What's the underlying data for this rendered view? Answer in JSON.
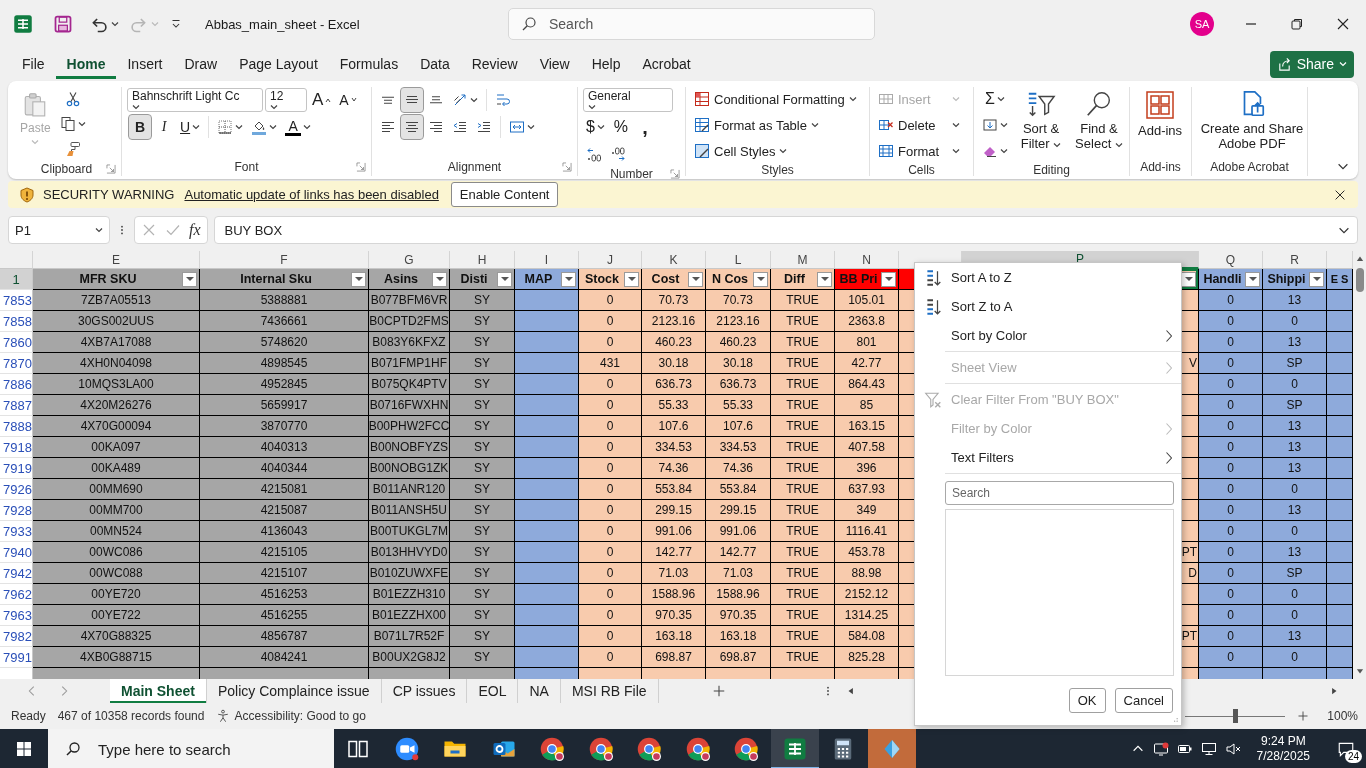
{
  "window": {
    "title": "Abbas_main_sheet - Excel",
    "search_placeholder": "Search",
    "user_initials": "SA"
  },
  "menu_tabs": [
    {
      "label": "File",
      "selected": false
    },
    {
      "label": "Home",
      "selected": true
    },
    {
      "label": "Insert",
      "selected": false
    },
    {
      "label": "Draw",
      "selected": false
    },
    {
      "label": "Page Layout",
      "selected": false
    },
    {
      "label": "Formulas",
      "selected": false
    },
    {
      "label": "Data",
      "selected": false
    },
    {
      "label": "Review",
      "selected": false
    },
    {
      "label": "View",
      "selected": false
    },
    {
      "label": "Help",
      "selected": false
    },
    {
      "label": "Acrobat",
      "selected": false
    }
  ],
  "share_button": "Share",
  "ribbon": {
    "groups": [
      {
        "kind": "clipboard",
        "label": "Clipboard",
        "launcher": true,
        "paste_label": "Paste",
        "paste_disabled": true
      },
      {
        "kind": "font",
        "label": "Font",
        "launcher": true,
        "font_name": "Bahnschrift Light Cc",
        "font_size": "12",
        "grow_label": "A",
        "shrink_label": "A",
        "bold_label": "B",
        "italic_label": "I",
        "underline_label": "U",
        "font_color_label": "A",
        "bold": true,
        "italic": false,
        "underline": false
      },
      {
        "kind": "alignment",
        "label": "Alignment",
        "launcher": true,
        "vertical_align": [
          {
            "selected": false
          },
          {
            "selected": true
          },
          {
            "selected": false
          }
        ],
        "horizontal_align": [
          {
            "selected": false
          },
          {
            "selected": true
          },
          {
            "selected": false
          }
        ]
      },
      {
        "kind": "number",
        "label": "Number",
        "launcher": true,
        "format": "General",
        "currency_label": "$",
        "percent_label": "%",
        "comma_label": ","
      },
      {
        "kind": "styles",
        "label": "Styles",
        "launcher": false,
        "commands": [
          "Conditional Formatting",
          "Format as Table",
          "Cell Styles"
        ]
      },
      {
        "kind": "cells",
        "label": "Cells",
        "launcher": false,
        "commands": [
          {
            "label": "Insert",
            "disabled": true
          },
          {
            "label": "Delete",
            "disabled": false
          },
          {
            "label": "Format",
            "disabled": false
          }
        ]
      },
      {
        "kind": "editing",
        "label": "Editing",
        "launcher": false,
        "sum_label": "Σ",
        "sort_filter": "Sort & Filter",
        "find_select": "Find & Select"
      },
      {
        "kind": "addins",
        "label": "Add-ins",
        "launcher": false,
        "button": "Add-ins"
      },
      {
        "kind": "acrobat",
        "label": "Adobe Acrobat",
        "launcher": false,
        "button": "Create and Share Adobe PDF"
      }
    ]
  },
  "security_bar": {
    "title": "SECURITY WARNING",
    "message": "Automatic update of links has been disabled",
    "button": "Enable Content"
  },
  "formula_bar": {
    "name_box": "P1",
    "function_label": "fx",
    "formula": "BUY BOX"
  },
  "sheet": {
    "header_row_number": "1",
    "header_row_selected": true,
    "columns": [
      {
        "letter": "E",
        "header": {
          "label": "MFR SKU",
          "color": "#a6a6a6"
        },
        "color": "#a6a6a6",
        "filter": true,
        "selected": false
      },
      {
        "letter": "F",
        "header": {
          "label": "Internal Sku",
          "color": "#a6a6a6"
        },
        "color": "#a6a6a6",
        "filter": true,
        "selected": false
      },
      {
        "letter": "G",
        "header": {
          "label": "Asins",
          "color": "#a6a6a6"
        },
        "color": "#a6a6a6",
        "filter": true,
        "selected": false
      },
      {
        "letter": "H",
        "header": {
          "label": "Disti",
          "color": "#a6a6a6"
        },
        "color": "#a6a6a6",
        "filter": true,
        "selected": false
      },
      {
        "letter": "I",
        "header": {
          "label": "MAP",
          "color": "#8eaadb"
        },
        "color": "#8eaadb",
        "filter": true,
        "selected": false
      },
      {
        "letter": "J",
        "header": {
          "label": "Stock",
          "color": "#f8cbad"
        },
        "color": "#f8cbad",
        "filter": true,
        "selected": false
      },
      {
        "letter": "K",
        "header": {
          "label": "Cost",
          "color": "#f8cbad"
        },
        "color": "#f8cbad",
        "filter": true,
        "selected": false
      },
      {
        "letter": "L",
        "header": {
          "label": "N Cos",
          "color": "#f8cbad"
        },
        "color": "#f8cbad",
        "filter": true,
        "selected": false
      },
      {
        "letter": "M",
        "header": {
          "label": "Diff",
          "color": "#f8cbad"
        },
        "color": "#f8cbad",
        "filter": true,
        "selected": false
      },
      {
        "letter": "N",
        "header": {
          "label": "BB Pri",
          "color": "#ff0000"
        },
        "color": "#f8cbad",
        "filter": true,
        "selected": false
      },
      {
        "header": {
          "color": "#ff0000"
        },
        "color": "#f8cbad",
        "selected": false
      },
      {
        "letter": "P",
        "header": {
          "color": "#f8cbad"
        },
        "color": "#f8cbad",
        "filter": true,
        "selected": true
      },
      {
        "letter": "Q",
        "header": {
          "label": "Handli",
          "color": "#8eaadb"
        },
        "color": "#8eaadb",
        "filter": true,
        "selected": false
      },
      {
        "letter": "R",
        "header": {
          "label": "Shippi",
          "color": "#8eaadb"
        },
        "color": "#8eaadb",
        "filter": true,
        "selected": false
      },
      {
        "header": {
          "label": "E S",
          "color": "#8eaadb"
        },
        "color": "#8eaadb",
        "filter": false,
        "selected": false
      }
    ],
    "rows": [
      {
        "number": "7853",
        "cells": {
          "E": "7ZB7A05513",
          "F": "5388881",
          "G": "B077BFM6VR",
          "H": "SY",
          "J": "0",
          "K": "70.73",
          "L": "70.73",
          "M": "TRUE",
          "N": "105.01",
          "Q": "0",
          "R": "13"
        }
      },
      {
        "number": "7858",
        "cells": {
          "E": "30GS002UUS",
          "F": "7436661",
          "G": "B0CPTD2FMS",
          "H": "SY",
          "J": "0",
          "K": "2123.16",
          "L": "2123.16",
          "M": "TRUE",
          "N": "2363.8",
          "Q": "0",
          "R": "0"
        }
      },
      {
        "number": "7860",
        "cells": {
          "E": "4XB7A17088",
          "F": "5748620",
          "G": "B083Y6KFXZ",
          "H": "SY",
          "J": "0",
          "K": "460.23",
          "L": "460.23",
          "M": "TRUE",
          "N": "801",
          "Q": "0",
          "R": "13"
        }
      },
      {
        "number": "7870",
        "cells": {
          "E": "4XH0N04098",
          "F": "4898545",
          "G": "B071FMP1HF",
          "H": "SY",
          "J": "431",
          "K": "30.18",
          "L": "30.18",
          "M": "TRUE",
          "N": "42.77",
          "P": "V",
          "Q": "0",
          "R": "SP"
        }
      },
      {
        "number": "7886",
        "cells": {
          "E": "10MQS3LA00",
          "F": "4952845",
          "G": "B075QK4PTV",
          "H": "SY",
          "J": "0",
          "K": "636.73",
          "L": "636.73",
          "M": "TRUE",
          "N": "864.43",
          "Q": "0",
          "R": "0"
        }
      },
      {
        "number": "7887",
        "cells": {
          "E": "4X20M26276",
          "F": "5659917",
          "G": "B0716FWXHN",
          "H": "SY",
          "J": "0",
          "K": "55.33",
          "L": "55.33",
          "M": "TRUE",
          "N": "85",
          "Q": "0",
          "R": "SP"
        }
      },
      {
        "number": "7888",
        "cells": {
          "E": "4X70G00094",
          "F": "3870770",
          "G": "B00PHW2FCC",
          "H": "SY",
          "J": "0",
          "K": "107.6",
          "L": "107.6",
          "M": "TRUE",
          "N": "163.15",
          "Q": "0",
          "R": "13"
        }
      },
      {
        "number": "7918",
        "cells": {
          "E": "00KA097",
          "F": "4040313",
          "G": "B00NOBFYZS",
          "H": "SY",
          "J": "0",
          "K": "334.53",
          "L": "334.53",
          "M": "TRUE",
          "N": "407.58",
          "Q": "0",
          "R": "13"
        }
      },
      {
        "number": "7919",
        "cells": {
          "E": "00KA489",
          "F": "4040344",
          "G": "B00NOBG1ZK",
          "H": "SY",
          "J": "0",
          "K": "74.36",
          "L": "74.36",
          "M": "TRUE",
          "N": "396",
          "Q": "0",
          "R": "13"
        }
      },
      {
        "number": "7926",
        "cells": {
          "E": "00MM690",
          "F": "4215081",
          "G": "B011ANR120",
          "H": "SY",
          "J": "0",
          "K": "553.84",
          "L": "553.84",
          "M": "TRUE",
          "N": "637.93",
          "Q": "0",
          "R": "0"
        }
      },
      {
        "number": "7928",
        "cells": {
          "E": "00MM700",
          "F": "4215087",
          "G": "B011ANSH5U",
          "H": "SY",
          "J": "0",
          "K": "299.15",
          "L": "299.15",
          "M": "TRUE",
          "N": "349",
          "Q": "0",
          "R": "13"
        }
      },
      {
        "number": "7933",
        "cells": {
          "E": "00MN524",
          "F": "4136043",
          "G": "B00TUKGL7M",
          "H": "SY",
          "J": "0",
          "K": "991.06",
          "L": "991.06",
          "M": "TRUE",
          "N": "1116.41",
          "Q": "0",
          "R": "0"
        }
      },
      {
        "number": "7940",
        "cells": {
          "E": "00WC086",
          "F": "4215105",
          "G": "B013HHVYD0",
          "H": "SY",
          "J": "0",
          "K": "142.77",
          "L": "142.77",
          "M": "TRUE",
          "N": "453.78",
          "P": "PT",
          "Q": "0",
          "R": "13"
        }
      },
      {
        "number": "7942",
        "cells": {
          "E": "00WC088",
          "F": "4215107",
          "G": "B010ZUWXFE",
          "H": "SY",
          "J": "0",
          "K": "71.03",
          "L": "71.03",
          "M": "TRUE",
          "N": "88.98",
          "P": "D",
          "Q": "0",
          "R": "SP"
        }
      },
      {
        "number": "7962",
        "cells": {
          "E": "00YE720",
          "F": "4516253",
          "G": "B01EZZH310",
          "H": "SY",
          "J": "0",
          "K": "1588.96",
          "L": "1588.96",
          "M": "TRUE",
          "N": "2152.12",
          "Q": "0",
          "R": "0"
        }
      },
      {
        "number": "7963",
        "cells": {
          "E": "00YE722",
          "F": "4516255",
          "G": "B01EZZHX00",
          "H": "SY",
          "J": "0",
          "K": "970.35",
          "L": "970.35",
          "M": "TRUE",
          "N": "1314.25",
          "Q": "0",
          "R": "0"
        }
      },
      {
        "number": "7982",
        "cells": {
          "E": "4X70G88325",
          "F": "4856787",
          "G": "B071L7R52F",
          "H": "SY",
          "J": "0",
          "K": "163.18",
          "L": "163.18",
          "M": "TRUE",
          "N": "584.08",
          "P": "PT",
          "Q": "0",
          "R": "13"
        }
      },
      {
        "number": "7991",
        "cells": {
          "E": "4XB0G88715",
          "F": "4084241",
          "G": "B00UX2G8J2",
          "H": "SY",
          "J": "0",
          "K": "698.87",
          "L": "698.87",
          "M": "TRUE",
          "N": "825.28",
          "Q": "0",
          "R": "0"
        }
      }
    ]
  },
  "filter_menu": {
    "items": [
      {
        "label": "Sort A to Z",
        "kind": "sort-ascending",
        "disabled": false,
        "submenu": false,
        "divider_after": false
      },
      {
        "label": "Sort Z to A",
        "kind": "sort-descending",
        "disabled": false,
        "submenu": false,
        "divider_after": false
      },
      {
        "label": "Sort by Color",
        "kind": "plain",
        "disabled": false,
        "submenu": true,
        "divider_after": true
      },
      {
        "label": "Sheet View",
        "kind": "plain",
        "disabled": true,
        "submenu": true,
        "divider_after": true
      },
      {
        "label": "Clear Filter From \"BUY BOX\"",
        "kind": "clear-filter",
        "disabled": true,
        "submenu": false,
        "divider_after": false
      },
      {
        "label": "Filter by Color",
        "kind": "plain",
        "disabled": true,
        "submenu": true,
        "divider_after": false
      },
      {
        "label": "Text Filters",
        "kind": "plain",
        "disabled": false,
        "submenu": true,
        "divider_after": true
      }
    ],
    "search_placeholder": "Search",
    "ok": "OK",
    "cancel": "Cancel"
  },
  "sheet_tabs": [
    {
      "label": "Main Sheet",
      "selected": true
    },
    {
      "label": "Policy Complaince issue",
      "selected": false
    },
    {
      "label": "CP issues",
      "selected": false
    },
    {
      "label": "EOL",
      "selected": false
    },
    {
      "label": "NA",
      "selected": false
    },
    {
      "label": "MSI RB File",
      "selected": false
    }
  ],
  "status_bar": {
    "mode": "Ready",
    "records": "467 of 10358 records found",
    "accessibility": "Accessibility: Good to go",
    "zoom": {
      "label": "100%",
      "level": 0.5
    }
  },
  "taskbar": {
    "search_placeholder": "Type here to search",
    "time": "9:24 PM",
    "date": "7/28/2025",
    "notifications": "24",
    "apps": [
      {
        "kind": "task-view",
        "active": false,
        "attention": false
      },
      {
        "kind": "video-call",
        "active": false,
        "attention": false
      },
      {
        "kind": "folder",
        "active": false,
        "attention": false
      },
      {
        "kind": "mail",
        "active": false,
        "attention": false
      },
      {
        "kind": "browser",
        "active": false,
        "attention": false
      },
      {
        "kind": "browser",
        "active": false,
        "attention": false
      },
      {
        "kind": "browser",
        "active": false,
        "attention": false
      },
      {
        "kind": "browser",
        "active": false,
        "attention": false
      },
      {
        "kind": "browser",
        "active": false,
        "attention": false
      },
      {
        "kind": "spreadsheet",
        "active": true,
        "attention": false
      },
      {
        "kind": "calculator",
        "active": false,
        "attention": false
      },
      {
        "kind": "app",
        "active": false,
        "attention": true
      }
    ]
  }
}
